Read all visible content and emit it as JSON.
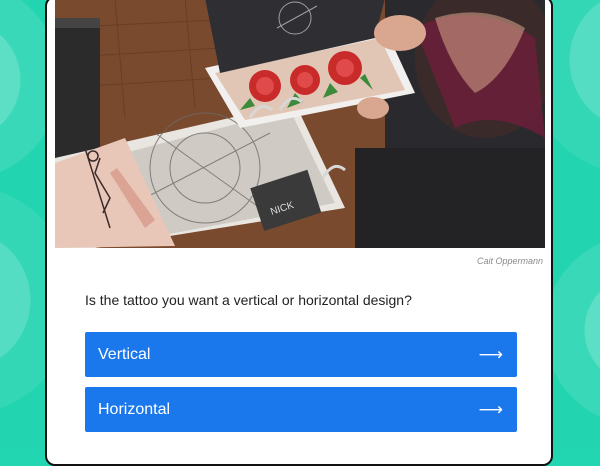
{
  "photo": {
    "credit": "Cait Oppermann",
    "alt_icon": "tattoo-portfolio-photo"
  },
  "quiz": {
    "question": "Is the tattoo you want a vertical or horizontal design?",
    "answers": [
      {
        "label": "Vertical",
        "icon": "arrow-right-icon",
        "glyph": "⟶"
      },
      {
        "label": "Horizontal",
        "icon": "arrow-right-icon",
        "glyph": "⟶"
      }
    ]
  },
  "colors": {
    "background": "#22d4b0",
    "button": "#1a78ec",
    "button_text": "#ffffff"
  }
}
